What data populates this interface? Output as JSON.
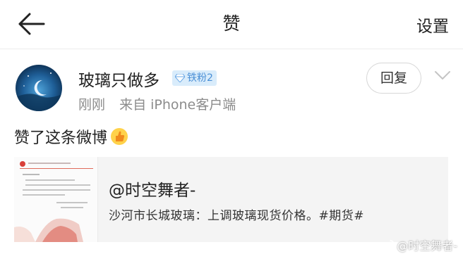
{
  "header": {
    "title": "赞",
    "settings_label": "设置",
    "back_icon": "arrow-left-icon"
  },
  "user": {
    "name": "玻璃只做多",
    "badge_label": "铁粉2",
    "badge_icon": "diamond-icon",
    "time": "刚刚",
    "source": "来自 iPhone客户端"
  },
  "actions": {
    "reply_label": "回复",
    "more_icon": "chevron-down-icon"
  },
  "post": {
    "text": "赞了这条微博",
    "emoji_icon": "thumbs-up-icon"
  },
  "quote": {
    "author": "@时空舞者-",
    "text": "沙河市长城玻璃：上调玻璃现货价格。#期货#"
  },
  "watermark": {
    "text": "@时空舞者-",
    "icon": "weibo-logo-icon"
  },
  "colors": {
    "badge_bg": "#d9ecfb",
    "badge_text": "#4a8fd6",
    "meta_text": "#8c8c8c",
    "card_bg": "#f4f4f4"
  }
}
